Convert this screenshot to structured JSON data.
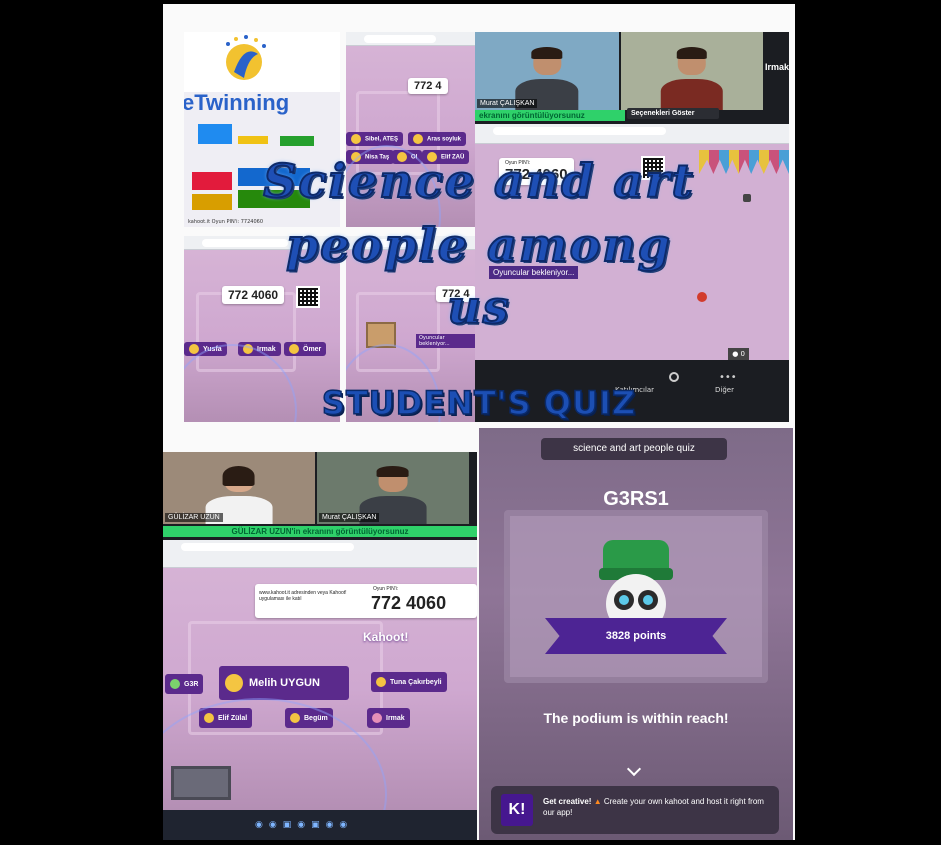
{
  "overlay": {
    "title_line1": "Science and art",
    "title_line2": "people among",
    "title_line3": "us",
    "subtitle": "STUDENT'S QUIZ"
  },
  "top_left": {
    "logo_text": "eTwinning",
    "pin_label": "Oyun PIN'i:",
    "pin_value": "772 4060",
    "footer_text": "kahoot.it Oyun PIN'i: 7724060"
  },
  "top_middle": {
    "pin_value": "772 4",
    "chips": [
      "Sibel, ATEŞ",
      "Aras soyluk",
      "Nisa Taş",
      "Ol",
      "Elif ZAÜ"
    ],
    "overlay_tag": "Oyuncular bekleniyor..."
  },
  "top_middle_lower": {
    "pin_value": "772 4060",
    "chips": [
      "Yusfa",
      "Irmak",
      "Ömer"
    ]
  },
  "top_right": {
    "video1_name": "Murat ÇALIŞKAN",
    "video2_name": "Irmak",
    "share_notice": "ekranını görüntülüyorsunuz",
    "options_button": "Seçenekleri Göster",
    "pin_label": "Oyun PIN'i:",
    "pin_value": "772 4060",
    "waiting_tag": "Oyuncular bekleniyor...",
    "participant_count": "0",
    "toolbar_items": [
      "Katılımcılar",
      "Diğer"
    ]
  },
  "bottom_left": {
    "video1_name": "GÜLİZAR UZUN",
    "video2_name": "Murat ÇALIŞKAN",
    "share_notice": "GÜLİZAR UZUN'in ekranını görüntülüyorsunuz",
    "join_text": "www.kahoot.it adresinden veya Kahoot! uygulaması ile katıl",
    "pin_label": "Oyun PIN'i:",
    "pin_value": "772 4060",
    "logo": "Kahoot!",
    "featured_player": "Melih UYGUN",
    "chips": [
      "G3R",
      "Tuna Çakırbeyli",
      "Elif Zülal",
      "Begüm",
      "Irmak"
    ]
  },
  "bottom_right": {
    "quiz_title": "science and art people quiz",
    "nickname": "G3RS1",
    "points": "3828 points",
    "message": "The podium is within reach!",
    "banner_bold": "Get creative!",
    "banner_text": "Create your own kahoot and host it right from our app!",
    "banner_logo": "K!"
  },
  "colors": {
    "kahoot_purple": "#46178f",
    "title_blue": "#1e4fb5",
    "zoom_green": "#2fd16a"
  }
}
